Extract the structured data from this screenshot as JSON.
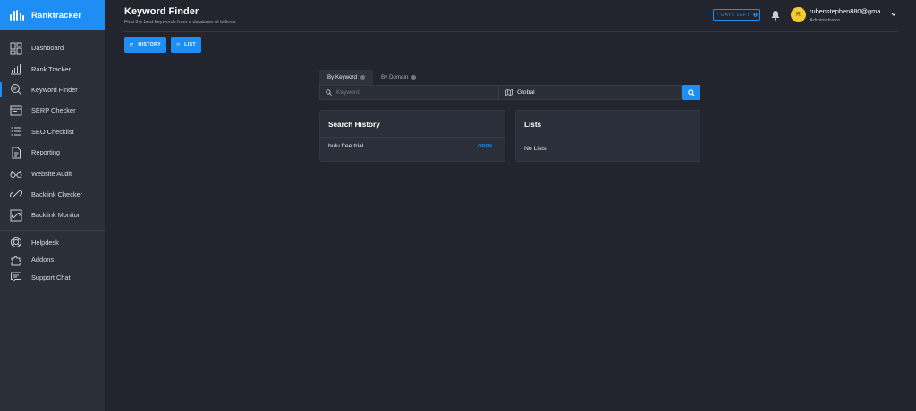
{
  "brand": {
    "name": "Ranktracker"
  },
  "sidebar": {
    "items": [
      {
        "label": "Dashboard",
        "icon": "dashboard-icon"
      },
      {
        "label": "Rank Tracker",
        "icon": "rank-tracker-icon"
      },
      {
        "label": "Keyword Finder",
        "icon": "keyword-finder-icon",
        "active": true
      },
      {
        "label": "SERP Checker",
        "icon": "serp-checker-icon"
      },
      {
        "label": "SEO Checklist",
        "icon": "seo-checklist-icon"
      },
      {
        "label": "Reporting",
        "icon": "reporting-icon"
      },
      {
        "label": "Website Audit",
        "icon": "website-audit-icon"
      },
      {
        "label": "Backlink Checker",
        "icon": "backlink-checker-icon"
      },
      {
        "label": "Backlink Monitor",
        "icon": "backlink-monitor-icon"
      }
    ],
    "support": [
      {
        "label": "Helpdesk",
        "icon": "helpdesk-icon"
      },
      {
        "label": "Addons",
        "icon": "addons-icon"
      },
      {
        "label": "Support Chat",
        "icon": "support-chat-icon"
      }
    ]
  },
  "header": {
    "title": "Keyword Finder",
    "subtitle": "Find the best keywords from a database of billions",
    "trial_label": "7 DAYS LEFT",
    "user_initial": "R",
    "user_email": "rubenstephen880@gma...",
    "user_role": "Administrator"
  },
  "toolbar": {
    "history_label": "HISTORY",
    "list_label": "LIST"
  },
  "search": {
    "tabs": [
      "By Keyword",
      "By Domain"
    ],
    "keyword_placeholder": "Keyword",
    "location_value": "Global"
  },
  "history_panel": {
    "title": "Search History",
    "items": [
      {
        "keyword": "hulu free trial",
        "action": "OPEN"
      }
    ]
  },
  "lists_panel": {
    "title": "Lists",
    "empty_text": "No Lists"
  },
  "colors": {
    "accent": "#1e8ef5",
    "background": "#22252e",
    "sidebar": "#2b2f38",
    "avatar": "#f2cc2e"
  }
}
